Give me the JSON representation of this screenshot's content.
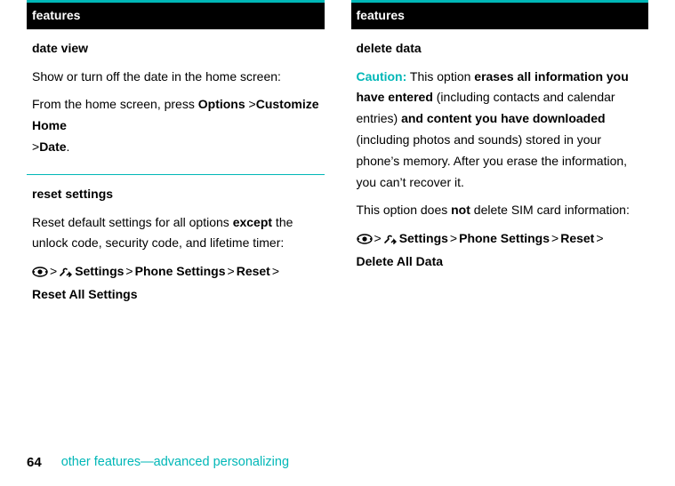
{
  "left": {
    "header": "features",
    "sections": [
      {
        "title": "date view",
        "body1": "Show or turn off the date in the home screen:",
        "body2_prefix": "From the home screen, press ",
        "path": {
          "opt": "Options",
          "s1": "Customize Home",
          "s2": "Date"
        }
      },
      {
        "title": "reset settings",
        "body_prefix": "Reset default settings for all options ",
        "except": "except",
        "body_suffix": " the unlock code, security code, and lifetime timer:",
        "menu": {
          "settings": "Settings",
          "phone": "Phone Settings",
          "reset": "Reset",
          "tail": "Reset All Settings"
        }
      }
    ]
  },
  "right": {
    "header": "features",
    "section": {
      "title": "delete data",
      "caution": "Caution:",
      "t1": " This option ",
      "b1": "erases all information you have entered",
      "t2": " (including contacts and calendar entries) ",
      "b2": "and content you have downloaded",
      "t3": " (including photos and sounds) stored in your phone’s memory. After you erase the information, you can’t recover it.",
      "p2a": "This option does ",
      "p2b": "not",
      "p2c": " delete SIM card information:",
      "menu": {
        "settings": "Settings",
        "phone": "Phone Settings",
        "reset": "Reset",
        "tail": "Delete All Data"
      }
    }
  },
  "footer": {
    "page": "64",
    "text": "other features—advanced personalizing"
  }
}
